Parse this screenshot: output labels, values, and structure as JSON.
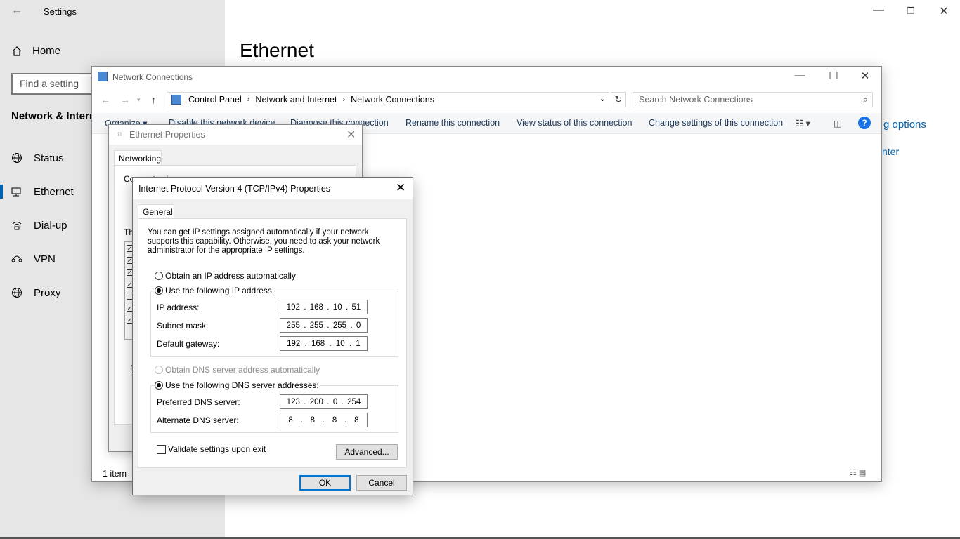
{
  "settings": {
    "title": "Settings",
    "back_icon": "←",
    "home_label": "Home",
    "search_placeholder": "Find a setting",
    "section_label": "Network & Internet",
    "nav": [
      {
        "label": "Status",
        "icon": "globe-icon"
      },
      {
        "label": "Ethernet",
        "icon": "ethernet-icon"
      },
      {
        "label": "Dial-up",
        "icon": "dialup-icon"
      },
      {
        "label": "VPN",
        "icon": "vpn-icon"
      },
      {
        "label": "Proxy",
        "icon": "globe-icon"
      }
    ],
    "active_nav": "Ethernet",
    "heading": "Ethernet",
    "link_fragment_1": "g options",
    "link_fragment_2": "nter",
    "accent_color": "#0063b1"
  },
  "network_connections": {
    "title": "Network Connections",
    "breadcrumb": [
      "Control Panel",
      "Network and Internet",
      "Network Connections"
    ],
    "search_placeholder": "Search Network Connections",
    "commands": {
      "organize": "Organize ▾",
      "disable": "Disable this network device",
      "diagnose": "Diagnose this connection",
      "rename": "Rename this connection",
      "view_status": "View status of this connection",
      "change_settings": "Change settings of this connection"
    },
    "status_text": "1 item"
  },
  "ethernet_properties": {
    "title": "Ethernet Properties",
    "tab": "Networking",
    "connect_fragment": "Connect using:",
    "this_fragment": "Th",
    "d_fragment": "D"
  },
  "ipv4": {
    "title": "Internet Protocol Version 4 (TCP/IPv4) Properties",
    "tab": "General",
    "description": "You can get IP settings assigned automatically if your network supports this capability. Otherwise, you need to ask your network administrator for the appropriate IP settings.",
    "obtain_ip_auto": "Obtain an IP address automatically",
    "use_following_ip": "Use the following IP address:",
    "ip_address_label": "IP address:",
    "ip_address": [
      "192",
      "168",
      "10",
      "51"
    ],
    "subnet_label": "Subnet mask:",
    "subnet_mask": [
      "255",
      "255",
      "255",
      "0"
    ],
    "gateway_label": "Default gateway:",
    "gateway": [
      "192",
      "168",
      "10",
      "1"
    ],
    "obtain_dns_auto": "Obtain DNS server address automatically",
    "use_following_dns": "Use the following DNS server addresses:",
    "preferred_dns_label": "Preferred DNS server:",
    "preferred_dns": [
      "123",
      "200",
      "0",
      "254"
    ],
    "alternate_dns_label": "Alternate DNS server:",
    "alternate_dns": [
      "8",
      "8",
      "8",
      "8"
    ],
    "validate_label": "Validate settings upon exit",
    "advanced_label": "Advanced...",
    "ok_label": "OK",
    "cancel_label": "Cancel"
  }
}
